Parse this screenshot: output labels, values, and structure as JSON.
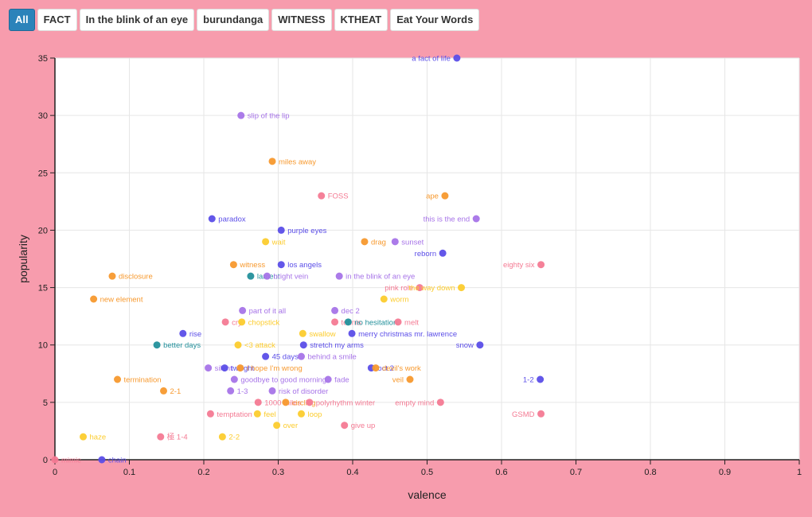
{
  "filters": {
    "buttons": [
      {
        "label": "All",
        "active": true
      },
      {
        "label": "FACT",
        "active": false
      },
      {
        "label": "In the blink of an eye",
        "active": false
      },
      {
        "label": "burundanga",
        "active": false
      },
      {
        "label": "WITNESS",
        "active": false
      },
      {
        "label": "KTHEAT",
        "active": false
      },
      {
        "label": "Eat Your Words",
        "active": false
      }
    ]
  },
  "colors": {
    "blue": "#5b4ee8",
    "purple": "#a774e8",
    "orange": "#f7992e",
    "pink": "#f47a93",
    "yellow": "#fccc2e",
    "teal": "#23909b",
    "background": "#f79cad",
    "plot_background": "#ffffff"
  },
  "chart_data": {
    "type": "scatter",
    "title": "",
    "xlabel": "valence",
    "ylabel": "popularity",
    "xlim": [
      0,
      1
    ],
    "ylim": [
      0,
      35
    ],
    "xticks": [
      "0",
      "0.1",
      "0.2",
      "0.3",
      "0.4",
      "0.5",
      "0.6",
      "0.7",
      "0.8",
      "0.9",
      "1"
    ],
    "yticks": [
      "0",
      "5",
      "10",
      "15",
      "20",
      "25",
      "30",
      "35"
    ],
    "grid": true,
    "points": [
      {
        "label": "a fact of life",
        "x": 0.54,
        "y": 35,
        "color": "blue",
        "side": "left"
      },
      {
        "label": "slip of the lip",
        "x": 0.25,
        "y": 30,
        "color": "purple",
        "side": "right"
      },
      {
        "label": "miles away",
        "x": 0.292,
        "y": 26,
        "color": "orange",
        "side": "right"
      },
      {
        "label": "FOSS",
        "x": 0.358,
        "y": 23,
        "color": "pink",
        "side": "right"
      },
      {
        "label": "ape",
        "x": 0.524,
        "y": 23,
        "color": "orange",
        "side": "left"
      },
      {
        "label": "paradox",
        "x": 0.211,
        "y": 21,
        "color": "blue",
        "side": "right"
      },
      {
        "label": "this is the end",
        "x": 0.566,
        "y": 21,
        "color": "purple",
        "side": "left"
      },
      {
        "label": "purple eyes",
        "x": 0.304,
        "y": 20,
        "color": "blue",
        "side": "right"
      },
      {
        "label": "wait",
        "x": 0.283,
        "y": 19,
        "color": "yellow",
        "side": "right"
      },
      {
        "label": "drag",
        "x": 0.416,
        "y": 19,
        "color": "orange",
        "side": "right"
      },
      {
        "label": "sunset",
        "x": 0.457,
        "y": 19,
        "color": "purple",
        "side": "right"
      },
      {
        "label": "reborn",
        "x": 0.521,
        "y": 18,
        "color": "blue",
        "side": "left"
      },
      {
        "label": "witness",
        "x": 0.24,
        "y": 17,
        "color": "orange",
        "side": "right"
      },
      {
        "label": "los angels",
        "x": 0.304,
        "y": 17,
        "color": "blue",
        "side": "right"
      },
      {
        "label": "eighty six",
        "x": 0.653,
        "y": 17,
        "color": "pink",
        "side": "left"
      },
      {
        "label": "disclosure",
        "x": 0.077,
        "y": 16,
        "color": "orange",
        "side": "right"
      },
      {
        "label": "lament",
        "x": 0.263,
        "y": 16,
        "color": "teal",
        "side": "right"
      },
      {
        "label": "bright vein",
        "x": 0.285,
        "y": 16,
        "color": "purple",
        "side": "right"
      },
      {
        "label": "in the blink of an eye",
        "x": 0.382,
        "y": 16,
        "color": "purple",
        "side": "right"
      },
      {
        "label": "pink role",
        "x": 0.49,
        "y": 15,
        "color": "pink",
        "side": "left"
      },
      {
        "label": "the way down",
        "x": 0.546,
        "y": 15,
        "color": "yellow",
        "side": "left"
      },
      {
        "label": "new element",
        "x": 0.052,
        "y": 14,
        "color": "orange",
        "side": "right"
      },
      {
        "label": "worm",
        "x": 0.442,
        "y": 14,
        "color": "yellow",
        "side": "right"
      },
      {
        "label": "part of it all",
        "x": 0.252,
        "y": 13,
        "color": "purple",
        "side": "right"
      },
      {
        "label": "dec 2",
        "x": 0.376,
        "y": 13,
        "color": "purple",
        "side": "right"
      },
      {
        "label": "cry",
        "x": 0.229,
        "y": 12,
        "color": "pink",
        "side": "right"
      },
      {
        "label": "chopstick",
        "x": 0.251,
        "y": 12,
        "color": "yellow",
        "side": "right"
      },
      {
        "label": "tennis",
        "x": 0.376,
        "y": 12,
        "color": "pink",
        "side": "right"
      },
      {
        "label": "no hesitation",
        "x": 0.394,
        "y": 12,
        "color": "teal",
        "side": "right"
      },
      {
        "label": "melt",
        "x": 0.461,
        "y": 12,
        "color": "pink",
        "side": "right"
      },
      {
        "label": "rise",
        "x": 0.172,
        "y": 11,
        "color": "blue",
        "side": "right"
      },
      {
        "label": "swallow",
        "x": 0.333,
        "y": 11,
        "color": "yellow",
        "side": "right"
      },
      {
        "label": "merry christmas mr. lawrence",
        "x": 0.399,
        "y": 11,
        "color": "blue",
        "side": "right"
      },
      {
        "label": "better days",
        "x": 0.137,
        "y": 10,
        "color": "teal",
        "side": "right"
      },
      {
        "label": "<3 attack",
        "x": 0.246,
        "y": 10,
        "color": "yellow",
        "side": "right"
      },
      {
        "label": "stretch my arms",
        "x": 0.334,
        "y": 10,
        "color": "blue",
        "side": "right"
      },
      {
        "label": "snow",
        "x": 0.571,
        "y": 10,
        "color": "blue",
        "side": "left"
      },
      {
        "label": "45 days",
        "x": 0.283,
        "y": 9,
        "color": "blue",
        "side": "right"
      },
      {
        "label": "behind a smile",
        "x": 0.331,
        "y": 9,
        "color": "purple",
        "side": "right"
      },
      {
        "label": "silent",
        "x": 0.206,
        "y": 8,
        "color": "purple",
        "side": "right"
      },
      {
        "label": "twilight",
        "x": 0.228,
        "y": 8,
        "color": "blue",
        "side": "right"
      },
      {
        "label": "I hope I'm wrong",
        "x": 0.249,
        "y": 8,
        "color": "orange",
        "side": "right"
      },
      {
        "label": "oct 2",
        "x": 0.425,
        "y": 8,
        "color": "blue",
        "side": "right"
      },
      {
        "label": "devil's work",
        "x": 0.431,
        "y": 8,
        "color": "orange",
        "side": "right"
      },
      {
        "label": "termination",
        "x": 0.084,
        "y": 7,
        "color": "orange",
        "side": "right"
      },
      {
        "label": "goodbye to good morning",
        "x": 0.241,
        "y": 7,
        "color": "purple",
        "side": "right"
      },
      {
        "label": "fade",
        "x": 0.367,
        "y": 7,
        "color": "purple",
        "side": "right"
      },
      {
        "label": "veil",
        "x": 0.477,
        "y": 7,
        "color": "orange",
        "side": "left"
      },
      {
        "label": "1-2",
        "x": 0.652,
        "y": 7,
        "color": "blue",
        "side": "left"
      },
      {
        "label": "2-1",
        "x": 0.146,
        "y": 6,
        "color": "orange",
        "side": "right"
      },
      {
        "label": "1-3",
        "x": 0.236,
        "y": 6,
        "color": "purple",
        "side": "right"
      },
      {
        "label": "risk of disorder",
        "x": 0.292,
        "y": 6,
        "color": "purple",
        "side": "right"
      },
      {
        "label": "1000 miles",
        "x": 0.273,
        "y": 5,
        "color": "pink",
        "side": "right"
      },
      {
        "label": "circling",
        "x": 0.31,
        "y": 5,
        "color": "orange",
        "side": "right"
      },
      {
        "label": "polyrhythm winter",
        "x": 0.342,
        "y": 5,
        "color": "pink",
        "side": "right"
      },
      {
        "label": "empty mind",
        "x": 0.518,
        "y": 5,
        "color": "pink",
        "side": "left"
      },
      {
        "label": "temptation",
        "x": 0.209,
        "y": 4,
        "color": "pink",
        "side": "right"
      },
      {
        "label": "feel",
        "x": 0.272,
        "y": 4,
        "color": "yellow",
        "side": "right"
      },
      {
        "label": "loop",
        "x": 0.331,
        "y": 4,
        "color": "yellow",
        "side": "right"
      },
      {
        "label": "GSMD",
        "x": 0.653,
        "y": 4,
        "color": "pink",
        "side": "left"
      },
      {
        "label": "over",
        "x": 0.298,
        "y": 3,
        "color": "yellow",
        "side": "right"
      },
      {
        "label": "give up",
        "x": 0.389,
        "y": 3,
        "color": "pink",
        "side": "right"
      },
      {
        "label": "haze",
        "x": 0.038,
        "y": 2,
        "color": "yellow",
        "side": "right"
      },
      {
        "label": "極 1-4",
        "x": 0.142,
        "y": 2,
        "color": "pink",
        "side": "right"
      },
      {
        "label": "2-2",
        "x": 0.225,
        "y": 2,
        "color": "yellow",
        "side": "right"
      },
      {
        "label": "mimic",
        "x": 0.0,
        "y": 0,
        "color": "pink",
        "side": "right"
      },
      {
        "label": "chain",
        "x": 0.063,
        "y": 0,
        "color": "blue",
        "side": "right"
      }
    ]
  }
}
